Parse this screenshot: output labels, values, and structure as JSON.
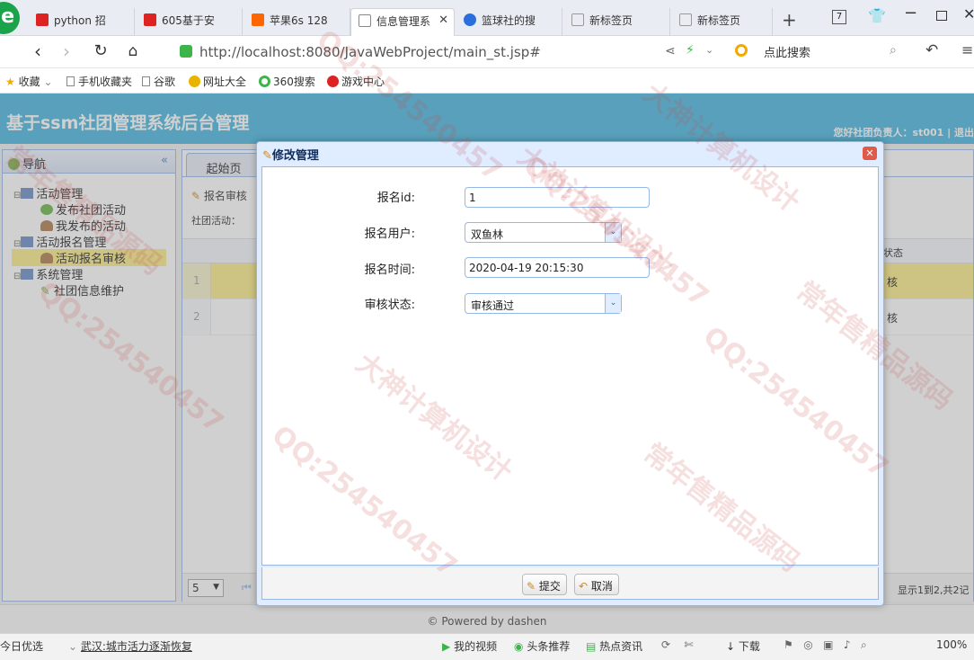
{
  "browser": {
    "tabs": [
      {
        "label": "python 招"
      },
      {
        "label": "605基于安"
      },
      {
        "label": "苹果6s 128"
      },
      {
        "label": "信息管理系"
      },
      {
        "label": "篮球社的搜"
      },
      {
        "label": "新标签页"
      },
      {
        "label": "新标签页"
      }
    ],
    "tab_count": "7",
    "url": "http://localhost:8080/JavaWebProject/main_st.jsp#",
    "search_placeholder": "点此搜索",
    "bookmarks": [
      "收藏",
      "手机收藏夹",
      "谷歌",
      "网址大全",
      "360搜索",
      "游戏中心"
    ]
  },
  "app": {
    "title": "基于ssm社团管理系统后台管理",
    "welcome": "您好社团负责人：st001 | 退出",
    "nav_title": "导航",
    "tree": [
      {
        "label": "活动管理"
      },
      {
        "label": "发布社团活动"
      },
      {
        "label": "我发布的活动"
      },
      {
        "label": "活动报名管理"
      },
      {
        "label": "活动报名审核"
      },
      {
        "label": "系统管理"
      },
      {
        "label": "社团信息维护"
      }
    ],
    "tabs": {
      "home": "起始页"
    },
    "grid": {
      "toolbar_label": "报名审核",
      "filter_label": "社团活动：",
      "status_header": "状态",
      "rows": [
        {
          "no": "1",
          "status": "核"
        },
        {
          "no": "2",
          "status": "核"
        }
      ],
      "page_size": "5",
      "summary": "显示1到2,共2记"
    },
    "footer": "© Powered by dashen"
  },
  "dialog": {
    "title": "修改管理",
    "fields": [
      {
        "label": "报名id:",
        "value": "1"
      },
      {
        "label": "报名用户:",
        "value": "双鱼林"
      },
      {
        "label": "报名时间:",
        "value": "2020-04-19 20:15:30"
      },
      {
        "label": "审核状态:",
        "value": "审核通过"
      }
    ],
    "submit": "提交",
    "cancel": "取消"
  },
  "statusbar": {
    "items": [
      "今日优选",
      "武汉:城市活力逐渐恢复",
      "我的视频",
      "头条推荐",
      "热点资讯",
      "下载",
      "100%"
    ]
  },
  "watermarks": [
    "QQ:254540457",
    "大神计算机设计",
    "常年售精品源码"
  ],
  "colors": {
    "header": "#47b5df",
    "highlight_row": "#fbec88",
    "panel_border": "#99bbe8"
  }
}
